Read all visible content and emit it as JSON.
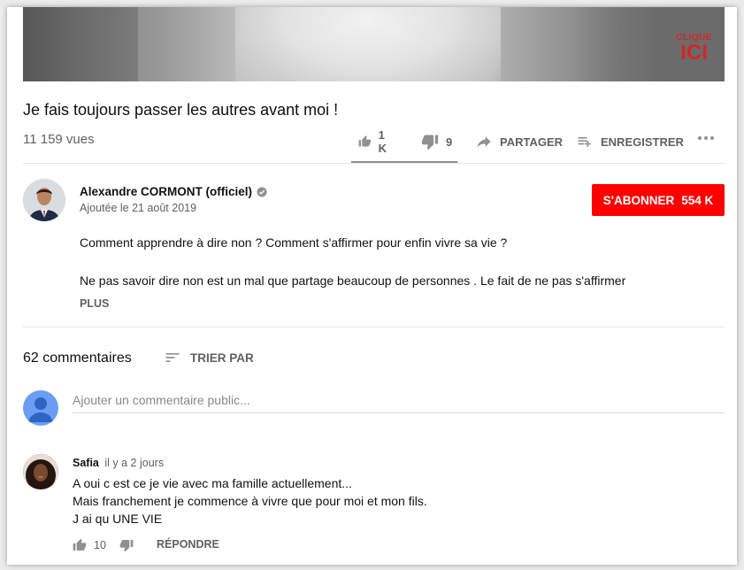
{
  "video": {
    "overlay_line1": "CLIQUE",
    "overlay_line2": "ICI",
    "title": "Je fais toujours passer les autres avant moi !",
    "views": "11 159 vues",
    "likes": "1 K",
    "dislikes": "9",
    "like_ratio": 0.99,
    "share_label": "PARTAGER",
    "save_label": "ENREGISTRER"
  },
  "channel": {
    "name": "Alexandre CORMONT (officiel)",
    "upload_date": "Ajoutée le 21 août 2019",
    "subscribe_label": "S'ABONNER",
    "subscriber_count": "554 K"
  },
  "description": {
    "line1": "Comment apprendre à dire non ? Comment s'affirmer pour enfin vivre sa vie ?",
    "line2": "Ne pas savoir dire non est un mal que partage beaucoup de personnes . Le fait de ne pas s'affirmer",
    "more_label": "PLUS"
  },
  "comments": {
    "count_label": "62 commentaires",
    "sort_label": "TRIER PAR",
    "input_placeholder": "Ajouter un commentaire public...",
    "items": [
      {
        "author": "Safia",
        "time": "il y a 2 jours",
        "lines": [
          "A oui c est ce je vie avec ma famille actuellement...",
          "Mais franchement je commence à vivre que pour moi et mon fils.",
          "J ai qu UNE VIE"
        ],
        "likes": "10",
        "reply_label": "RÉPONDRE"
      }
    ]
  },
  "colors": {
    "subscribe": "#ff0000",
    "icon_gray": "#909090",
    "overlay_red": "#d62525"
  }
}
